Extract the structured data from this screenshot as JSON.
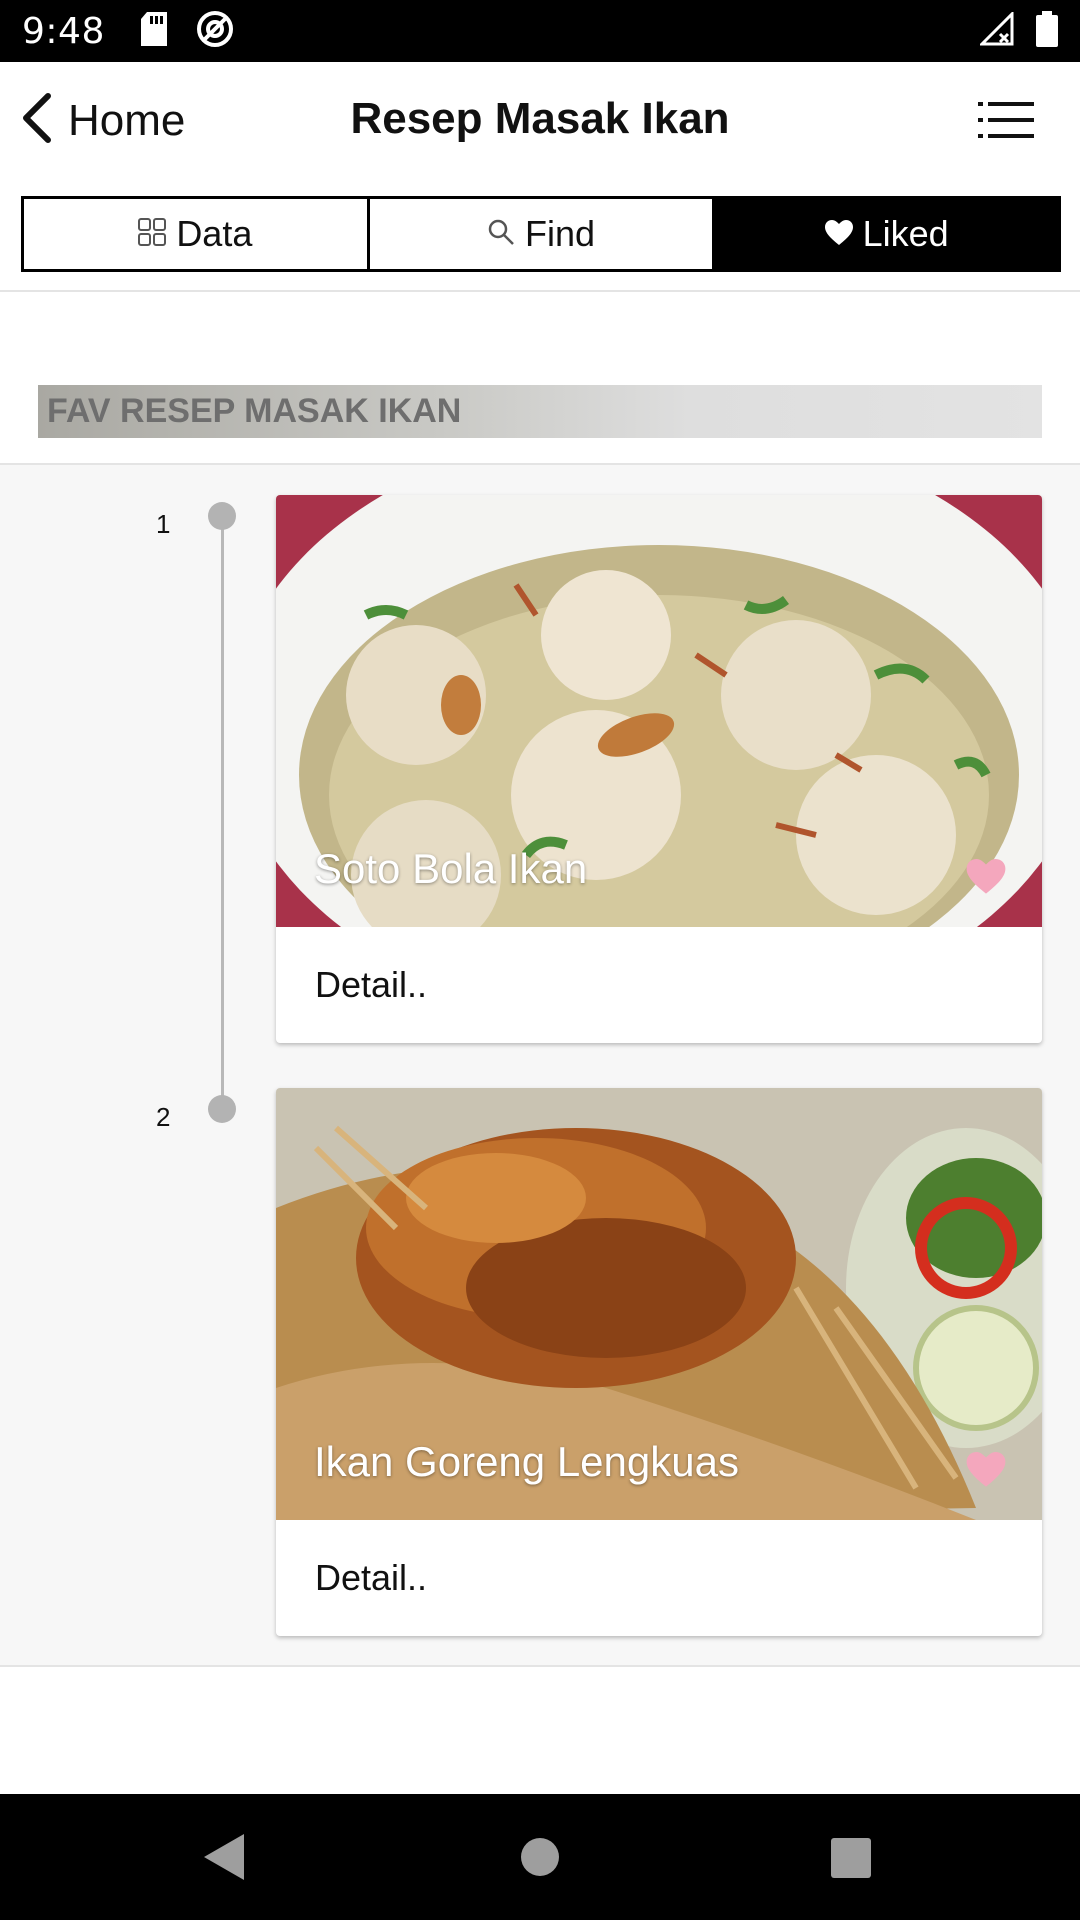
{
  "status_bar": {
    "time": "9:48",
    "icons_left": [
      "sd-card-icon",
      "at-sign-icon"
    ],
    "icons_right": [
      "signal-off-icon",
      "battery-icon"
    ]
  },
  "header": {
    "back_label": "Home",
    "title": "Resep Masak Ikan",
    "menu_icon": "list-menu-icon"
  },
  "tabs": [
    {
      "label": "Data",
      "icon": "grid-icon",
      "active": false
    },
    {
      "label": "Find",
      "icon": "search-icon",
      "active": false
    },
    {
      "label": "Liked",
      "icon": "heart-icon",
      "active": true
    }
  ],
  "section": {
    "title": "FAV RESEP MASAK IKAN"
  },
  "items": [
    {
      "index": "1",
      "title": "Soto Bola Ikan",
      "detail_label": "Detail..",
      "liked": true,
      "heart_color": "#f4a7bd"
    },
    {
      "index": "2",
      "title": "Ikan Goreng Lengkuas",
      "detail_label": "Detail..",
      "liked": true,
      "heart_color": "#f4a7bd"
    }
  ],
  "nav": {
    "back": "back-triangle-icon",
    "home": "home-circle-icon",
    "recents": "recents-square-icon"
  },
  "colors": {
    "active_tab_bg": "#000000",
    "section_title": "#6e6e6e",
    "heart": "#f4a7bd"
  }
}
